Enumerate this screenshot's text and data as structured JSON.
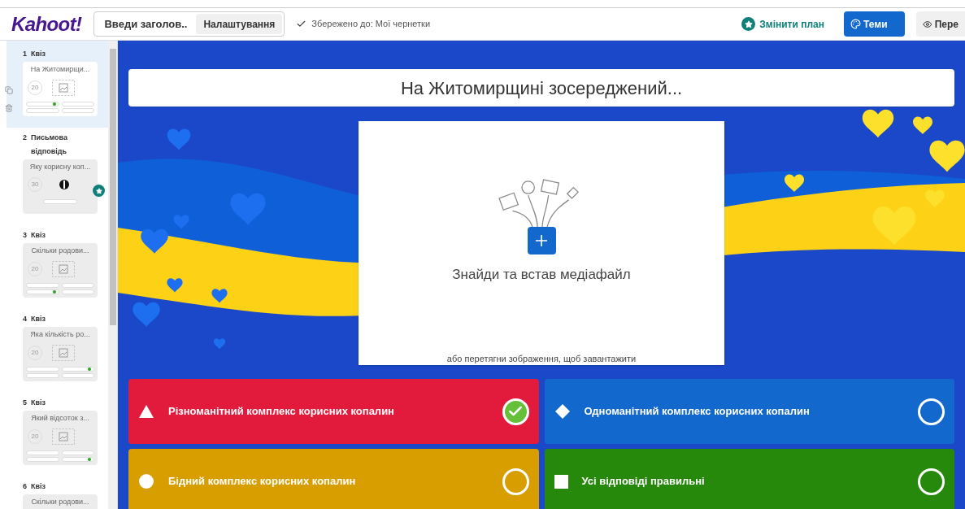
{
  "header": {
    "logo": "Kahoot!",
    "title_field": {
      "placeholder": "Введи заголов..."
    },
    "settings_button": "Налаштування",
    "save_status": "Збережено до: Мої чернетки",
    "upgrade_link": "Змінити план",
    "themes_button": "Теми",
    "preview_button": "Пере"
  },
  "slides": [
    {
      "number": "1",
      "type": "Квіз",
      "title": "На Житомирщи...",
      "time": "20",
      "kind": "quiz",
      "correct_flags": [
        true,
        false,
        false,
        false
      ],
      "selected": true
    },
    {
      "number": "2",
      "type": "Письмова відповідь",
      "title": "Яку корисну коп...",
      "time": "30",
      "kind": "open",
      "selected": false
    },
    {
      "number": "3",
      "type": "Квіз",
      "title": "Скільки родови...",
      "time": "20",
      "kind": "quiz",
      "correct_flags": [
        false,
        false,
        true,
        false
      ],
      "selected": false
    },
    {
      "number": "4",
      "type": "Квіз",
      "title": "Яка кількість ро...",
      "time": "20",
      "kind": "quiz",
      "correct_flags": [
        false,
        true,
        false,
        false
      ],
      "selected": false
    },
    {
      "number": "5",
      "type": "Квіз",
      "title": "Який відсоток з...",
      "time": "20",
      "kind": "quiz",
      "correct_flags": [
        false,
        false,
        false,
        true
      ],
      "selected": false
    },
    {
      "number": "6",
      "type": "Квіз",
      "title": "Скільки родови...",
      "kind": "quiz",
      "selected": false
    }
  ],
  "question": "На Житомирщині зосереджений...",
  "media": {
    "title": "Знайди та встав медіафайл",
    "hint": "або перетягни зображення, щоб завантажити"
  },
  "answers": [
    {
      "kind": "triangle",
      "color": "#e21b3c",
      "text": "Різноманітний комплекс корисних копалин",
      "correct": true
    },
    {
      "kind": "diamond",
      "color": "#1368ce",
      "text": "Одноманітний комплекс корисних копалин",
      "correct": false
    },
    {
      "kind": "circle",
      "color": "#d89e00",
      "text": "Бідний комплекс корисних копалин",
      "correct": false
    },
    {
      "kind": "square",
      "color": "#26890c",
      "text": "Усі відповіді правильні",
      "correct": false
    }
  ]
}
